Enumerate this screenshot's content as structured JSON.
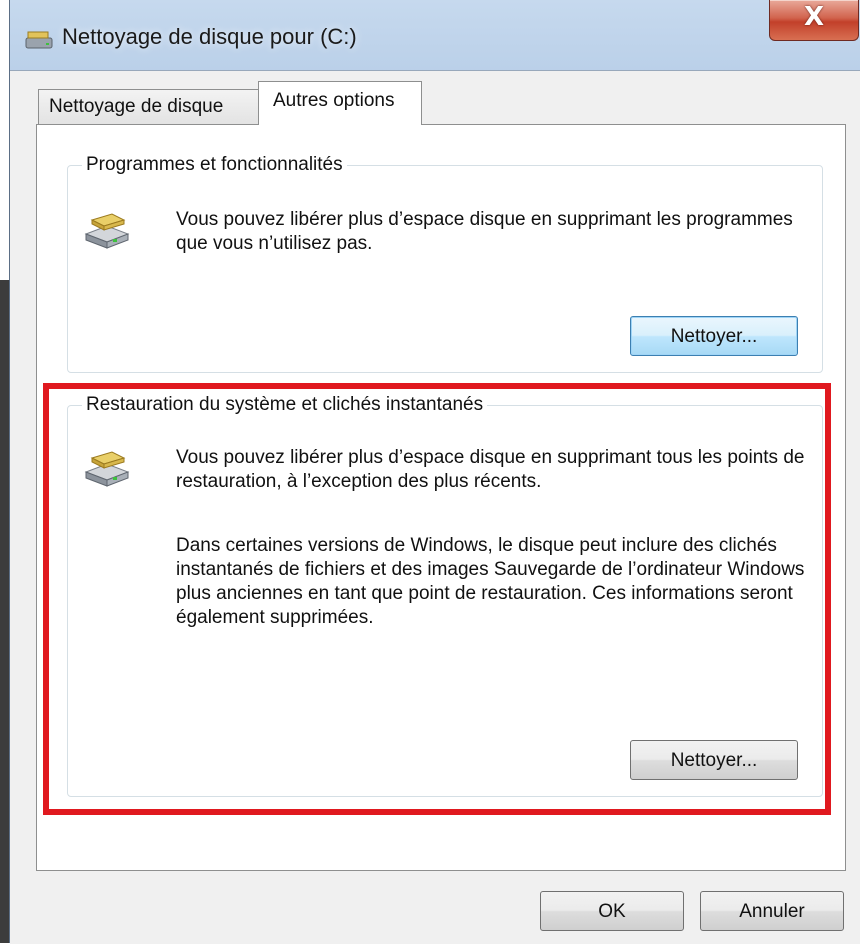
{
  "window": {
    "title": "Nettoyage de disque pour  (C:)",
    "close_label": "X"
  },
  "tabs": [
    {
      "label": "Nettoyage de disque",
      "active": false
    },
    {
      "label": "Autres options",
      "active": true
    }
  ],
  "groups": {
    "programs": {
      "title": "Programmes et fonctionnalités",
      "description": "Vous pouvez libérer plus d’espace disque en supprimant les programmes que vous n’utilisez pas.",
      "button_label": "Nettoyer...",
      "icon": "drive-cleanup-icon"
    },
    "restore": {
      "title": "Restauration du système et clichés instantanés",
      "description1": "Vous pouvez libérer plus d’espace disque en supprimant tous les points de restauration, à l’exception des plus récents.",
      "description2": "Dans certaines versions de Windows, le disque peut inclure des clichés instantanés de fichiers et des images Sauvegarde de l’ordinateur Windows plus anciennes en tant que point de restauration. Ces informations seront également supprimées.",
      "button_label": "Nettoyer...",
      "icon": "drive-cleanup-icon"
    }
  },
  "footer": {
    "ok_label": "OK",
    "cancel_label": "Annuler"
  },
  "colors": {
    "highlight": "#e0191f",
    "close_button": "#c2402a",
    "window_frame": "#bcd2ea"
  }
}
